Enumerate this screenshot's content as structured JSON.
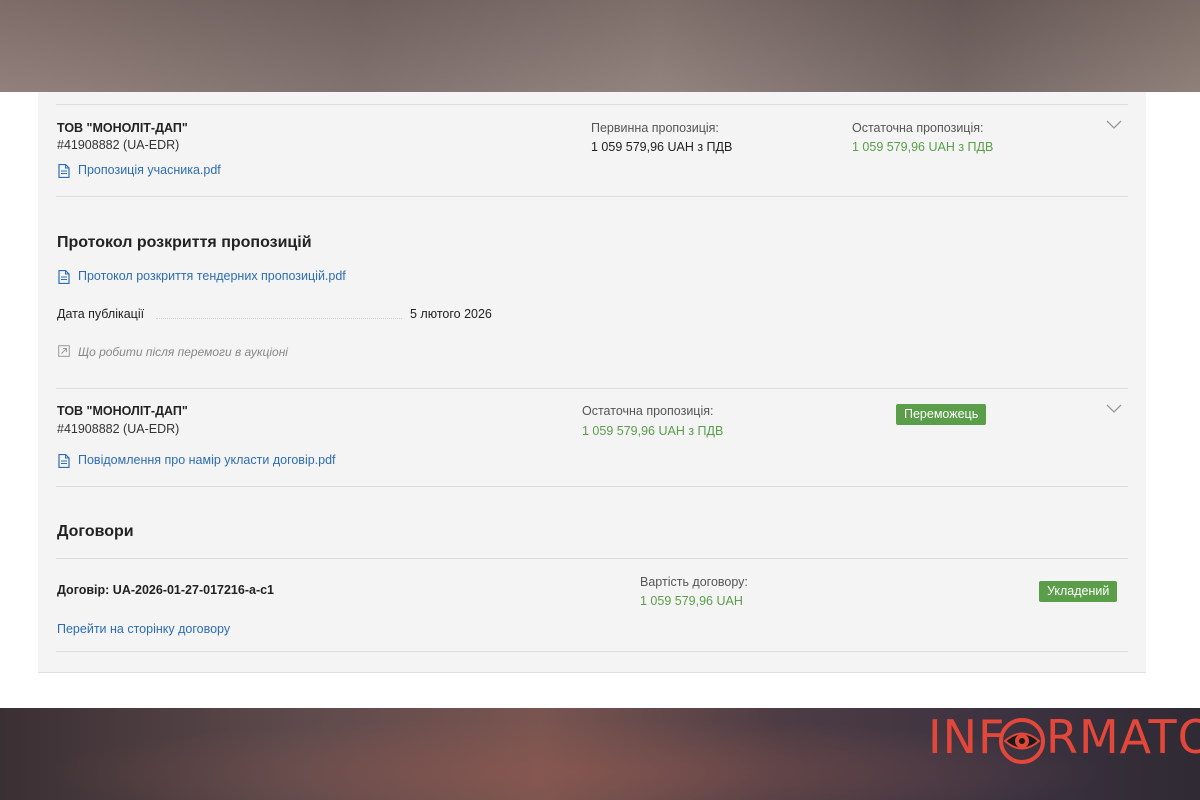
{
  "bid1": {
    "company": "ТОВ \"МОНОЛІТ-ДАП\"",
    "edr": "#41908882 (UA-EDR)",
    "file": "Пропозиція учасника.pdf",
    "initial_label": "Первинна пропозиція:",
    "initial_value": "1 059 579,96 UAH з ПДВ",
    "final_label": "Остаточна пропозиція:",
    "final_value": "1 059 579,96 UAH з ПДВ"
  },
  "protocol": {
    "title": "Протокол розкриття пропозицій",
    "file": "Протокол розкриття тендерних пропозицій.pdf",
    "date_label": "Дата публікації",
    "date_value": "5 лютого 2026",
    "help_link": "Що робити після перемоги в аукціоні"
  },
  "award": {
    "company": "ТОВ \"МОНОЛІТ-ДАП\"",
    "edr": "#41908882 (UA-EDR)",
    "final_label": "Остаточна пропозиція:",
    "final_value": "1 059 579,96 UAH з ПДВ",
    "badge": "Переможець",
    "file": "Повідомлення про намір укласти договір.pdf"
  },
  "contracts": {
    "title": "Договори",
    "contract_id": "Договір: UA-2026-01-27-017216-a-c1",
    "value_label": "Вартість договору:",
    "value": "1 059 579,96 UAH",
    "status": "Укладений",
    "link": "Перейти на сторінку договору"
  },
  "watermark": {
    "text_left": "INF",
    "text_right": "RMATOR",
    "icon": "eye-icon"
  },
  "colors": {
    "link": "#2d6db5",
    "green": "#5a9e4a",
    "badge": "#5a9e4a",
    "logo": "#e2473a"
  }
}
